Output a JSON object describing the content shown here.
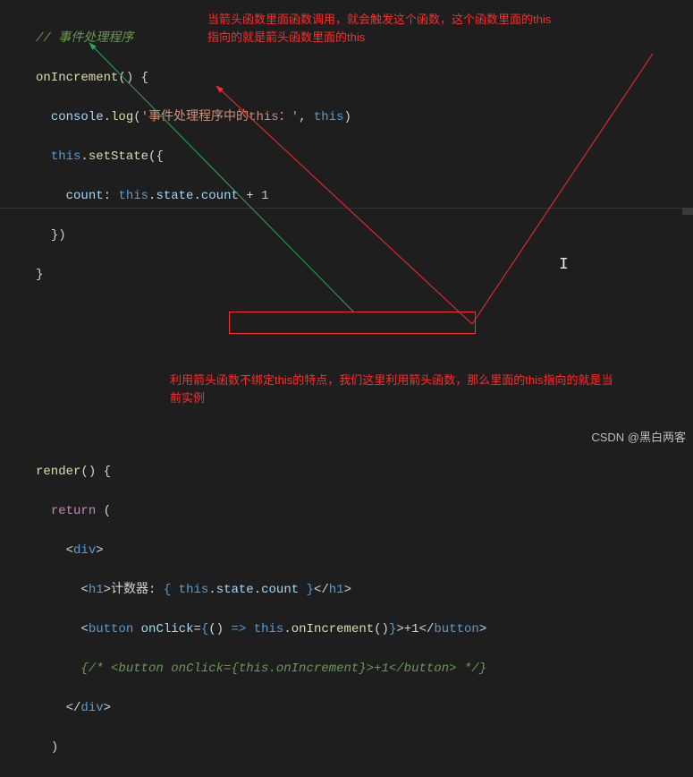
{
  "code": {
    "l1_comment": "// 事件处理程序",
    "l2_a": "onIncrement",
    "l2_b": "() {",
    "l3_a": "console",
    "l3_b": ".",
    "l3_c": "log",
    "l3_d": "(",
    "l3_e": "'事件处理程序中的this：'",
    "l3_f": ", ",
    "l3_g": "this",
    "l3_h": ")",
    "l4_a": "this",
    "l4_b": ".",
    "l4_c": "setState",
    "l4_d": "({",
    "l5_a": "count",
    "l5_b": ": ",
    "l5_c": "this",
    "l5_d": ".",
    "l5_e": "state",
    "l5_f": ".",
    "l5_g": "count",
    "l5_h": " + ",
    "l5_i": "1",
    "l6": "})",
    "l7": "}",
    "l9_a": "render",
    "l9_b": "() {",
    "l10_a": "return",
    "l10_b": " (",
    "l11_a": "<",
    "l11_b": "div",
    "l11_c": ">",
    "l12_a": "<",
    "l12_b": "h1",
    "l12_c": ">",
    "l12_d": "计数器: ",
    "l12_e": "{ ",
    "l12_f": "this",
    "l12_g": ".",
    "l12_h": "state",
    "l12_i": ".",
    "l12_j": "count",
    "l12_k": " }",
    "l12_l": "</",
    "l12_m": "h1",
    "l12_n": ">",
    "l13_a": "<",
    "l13_b": "button",
    "l13_c": " ",
    "l13_d": "onClick",
    "l13_e": "=",
    "l13_f": "{",
    "l13_g": "() ",
    "l13_h": "=>",
    "l13_i": " ",
    "l13_j": "this",
    "l13_k": ".",
    "l13_l": "onIncrement",
    "l13_m": "()",
    "l13_n": "}",
    "l13_o": ">",
    "l13_p": "+1",
    "l13_q": "</",
    "l13_r": "button",
    "l13_s": ">",
    "l14": "{/* <button onClick={this.onIncrement}>+1</button> */}",
    "l15_a": "</",
    "l15_b": "div",
    "l15_c": ">",
    "l16": ")"
  },
  "annotations": {
    "top1": "当箭头函数里面函数调用，就会触发这个函数，这个函数里面的this",
    "top2": "指向的就是箭头函数里面的this",
    "bottom1": "利用箭头函数不绑定this的特点，我们这里利用箭头函数，那么里面的this指向的就是当",
    "bottom2": "前实例"
  },
  "watermark": "CSDN @黑白两客"
}
